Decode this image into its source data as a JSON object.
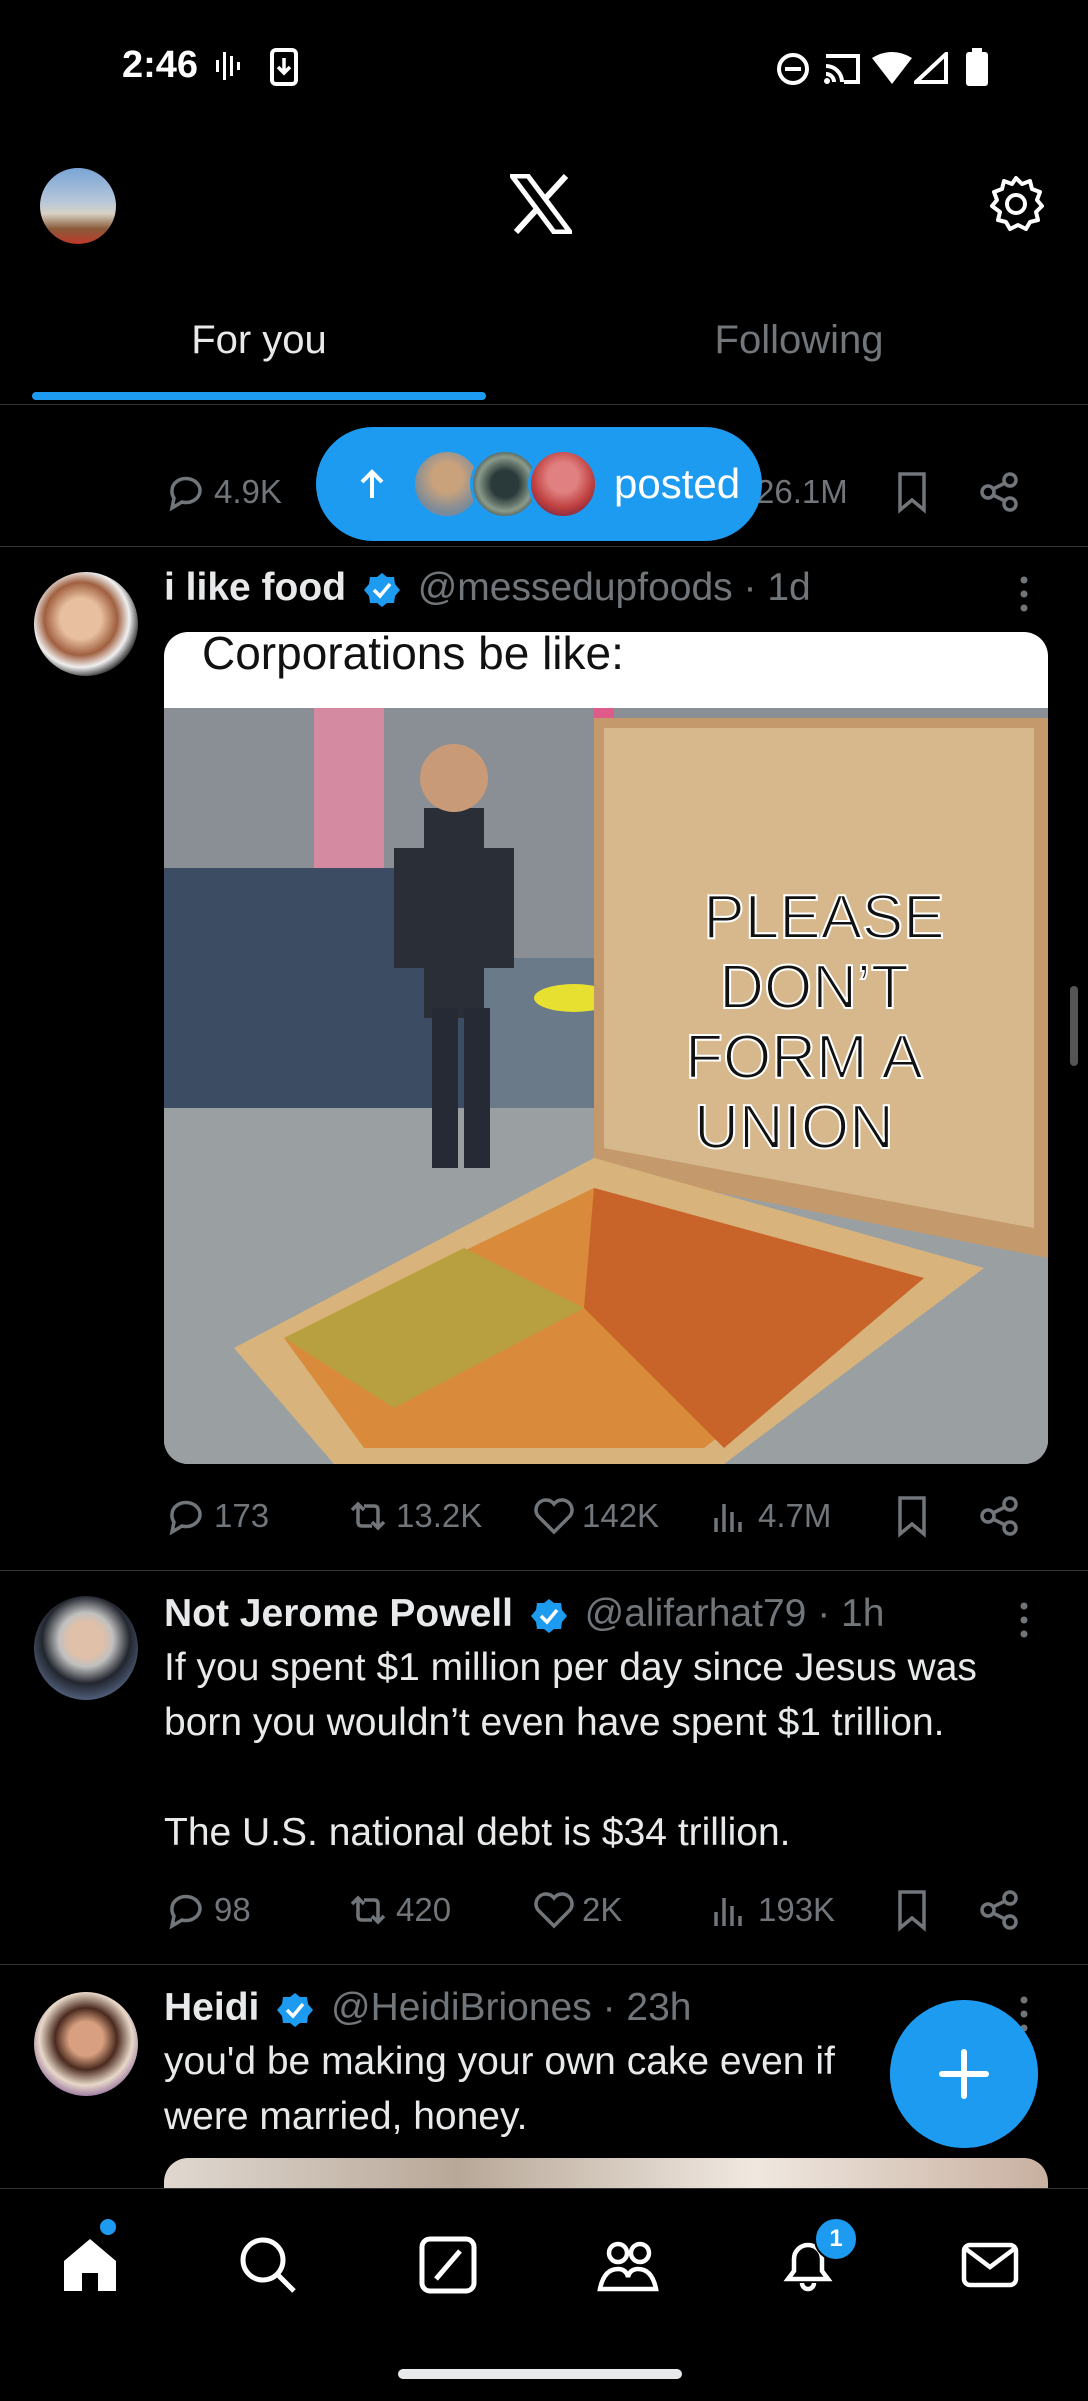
{
  "status_bar": {
    "time": "2:46"
  },
  "header": {
    "logo": "x-logo",
    "settings_icon": "gear-icon"
  },
  "tabs": [
    {
      "label": "For you",
      "selected": true
    },
    {
      "label": "Following",
      "selected": false
    }
  ],
  "new_posts_pill": {
    "label": "posted"
  },
  "partial_post": {
    "stats": {
      "replies": "4.9K",
      "views": "26.1M"
    }
  },
  "posts": [
    {
      "name": "i like food",
      "handle": "@messedupfoods",
      "time": "1d",
      "verified": true,
      "media": {
        "caption": "Corporations be like:",
        "box_text": [
          "PLEASE",
          "DON’T",
          "FORM A",
          "UNION"
        ]
      },
      "stats": {
        "replies": "173",
        "reposts": "13.2K",
        "likes": "142K",
        "views": "4.7M"
      }
    },
    {
      "name": "Not Jerome Powell",
      "handle": "@alifarhat79",
      "time": "1h",
      "verified": true,
      "text_lines": [
        "If you spent $1 million per day since Jesus was",
        "born you wouldn’t even have spent $1 trillion.",
        "",
        "The U.S. national debt is $34 trillion."
      ],
      "stats": {
        "replies": "98",
        "reposts": "420",
        "likes": "2K",
        "views": "193K"
      }
    },
    {
      "name": "Heidi",
      "handle": "@HeidiBriones",
      "time": "23h",
      "verified": true,
      "text_lines": [
        "you'd be making your own cake even if",
        "were married, honey."
      ]
    }
  ],
  "bottom_nav": {
    "items": [
      "home-icon",
      "search-icon",
      "grok-icon",
      "communities-icon",
      "notifications-icon",
      "messages-icon"
    ],
    "notification_badge": "1"
  },
  "colors": {
    "accent": "#1d9bf0",
    "background": "#000000",
    "muted": "#71767b",
    "text": "#e7e9ea"
  }
}
